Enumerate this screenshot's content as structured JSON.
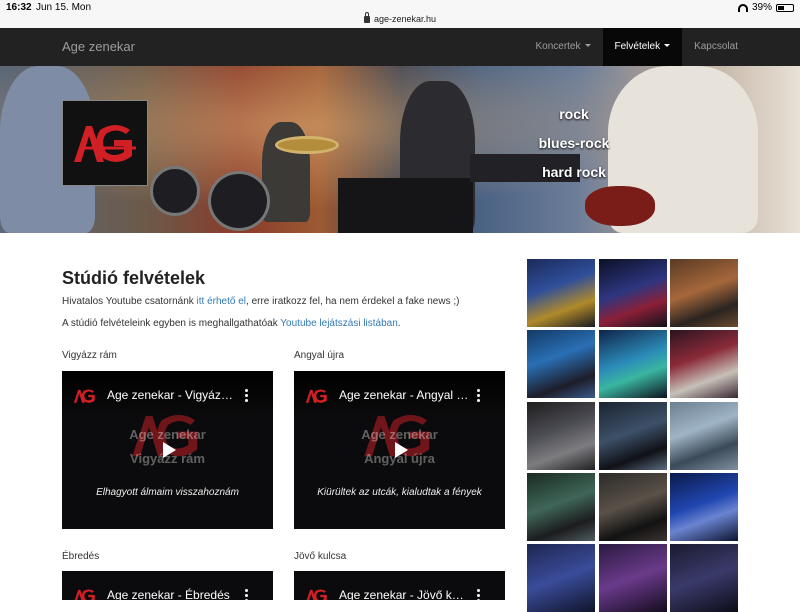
{
  "status": {
    "time": "16:32",
    "date": "Jun 15. Mon",
    "url": "age-zenekar.hu",
    "battery": "39%",
    "battery_level": 0.39
  },
  "navbar": {
    "brand": "Age zenekar",
    "items": [
      {
        "label": "Koncertek",
        "dropdown": true,
        "active": false
      },
      {
        "label": "Felvételek",
        "dropdown": true,
        "active": true
      },
      {
        "label": "Kapcsolat",
        "dropdown": false,
        "active": false
      }
    ]
  },
  "hero": {
    "tags": [
      "rock",
      "blues-rock",
      "hard rock"
    ]
  },
  "main": {
    "title": "Stúdió felvételek",
    "p1": {
      "before": "Hivatalos Youtube csatornánk ",
      "link": "itt érhető el",
      "after": ", erre iratkozz fel, ha nem érdekel a fake news ;)"
    },
    "p2": {
      "before": "A stúdió felvételeink egyben is meghallgathatóak ",
      "link": "Youtube lejátszási listában",
      "after": "."
    },
    "videos": [
      {
        "label": "Vigyázz rám",
        "title": "Age zenekar - Vigyázz rám",
        "bg_title": "Age zenekar",
        "bg_sub": "Vigyázz rám",
        "caption": "Elhagyott álmaim visszahoznám"
      },
      {
        "label": "Angyal újra",
        "title": "Age zenekar - Angyal újra",
        "bg_title": "Age zenekar",
        "bg_sub": "Angyal újra",
        "caption": "Kiürültek az utcák, kialudtak a fények"
      },
      {
        "label": "Ébredés",
        "title": "Age zenekar - Ébredés",
        "bg_title": "",
        "bg_sub": "",
        "caption": ""
      },
      {
        "label": "Jövő kulcsa",
        "title": "Age zenekar - Jövő kulcsa",
        "bg_title": "",
        "bg_sub": "",
        "caption": ""
      }
    ]
  },
  "colors": {
    "navbar": "#222222",
    "link": "#337ab7",
    "logo_red": "#d11f26"
  }
}
